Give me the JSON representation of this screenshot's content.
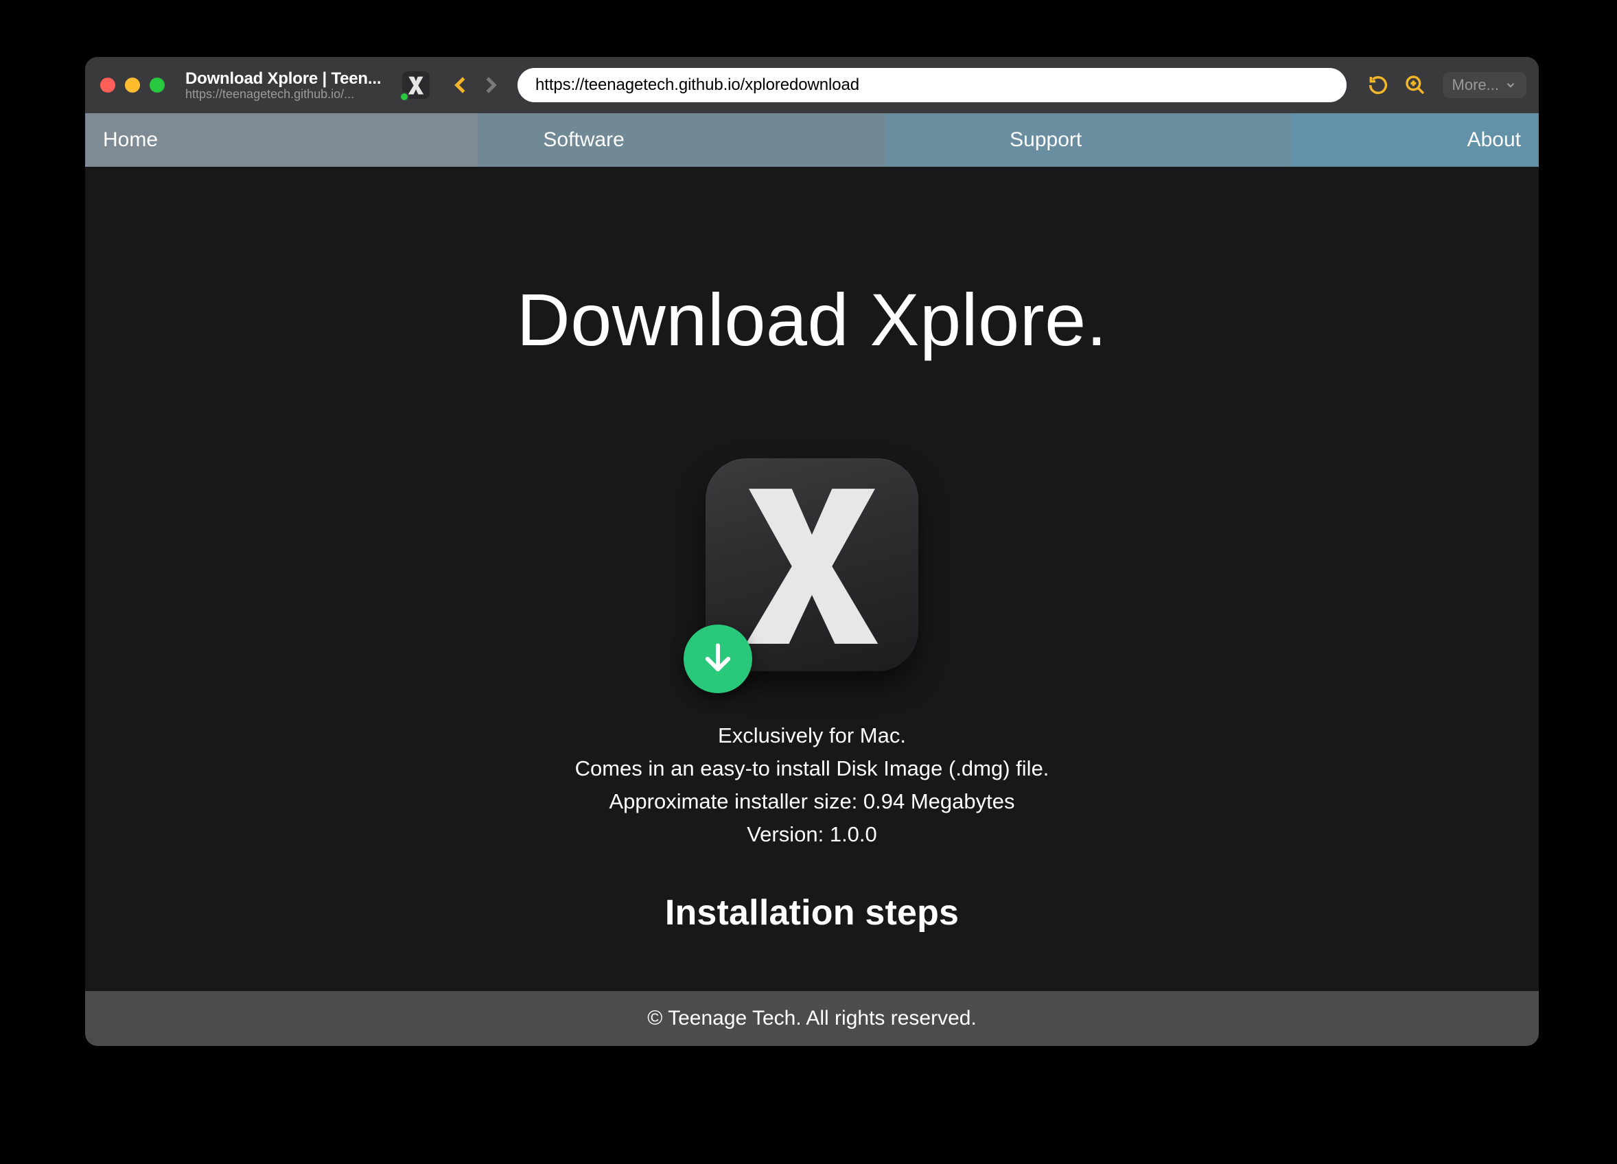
{
  "browser": {
    "tab_title": "Download Xplore | Teen...",
    "tab_subtitle": "https://teenagetech.github.io/...",
    "url": "https://teenagetech.github.io/xploredownload",
    "more_label": "More..."
  },
  "nav": {
    "items": [
      "Home",
      "Software",
      "Support",
      "About"
    ]
  },
  "page": {
    "hero_title": "Download Xplore.",
    "info_lines": [
      "Exclusively for Mac.",
      "Comes in an easy-to install Disk Image (.dmg) file.",
      "Approximate installer size: 0.94 Megabytes",
      "Version: 1.0.0"
    ],
    "section_title": "Installation steps",
    "footer": "© Teenage Tech. All rights reserved."
  }
}
